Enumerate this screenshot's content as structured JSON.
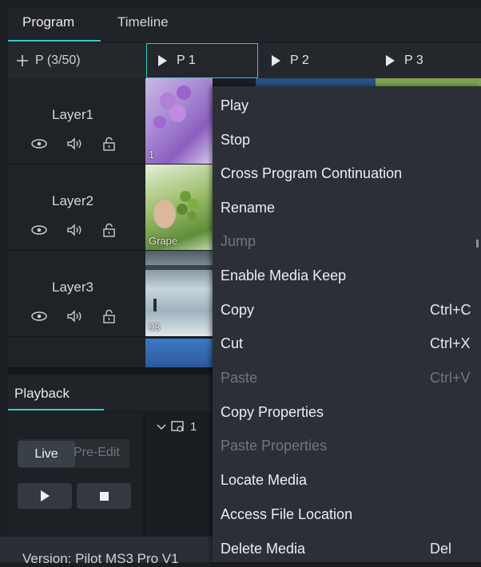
{
  "tabs": {
    "program": "Program",
    "timeline": "Timeline"
  },
  "program_header": {
    "add_label": "P (3/50)",
    "programs": [
      "P 1",
      "P 2",
      "P 3"
    ]
  },
  "layers": [
    {
      "name": "Layer1",
      "thumb_label": "1"
    },
    {
      "name": "Layer2",
      "thumb_label": "Grape"
    },
    {
      "name": "Layer3",
      "thumb_label": "03"
    }
  ],
  "playback": {
    "title": "Playback",
    "live": "Live",
    "pre_edit": "Pre-Edit",
    "mid_label": "1"
  },
  "version": "Version: Pilot MS3 Pro V1",
  "context_menu": {
    "items": [
      {
        "label": "Play",
        "shortcut": "",
        "enabled": true
      },
      {
        "label": "Stop",
        "shortcut": "",
        "enabled": true
      },
      {
        "label": "Cross Program Continuation",
        "shortcut": "",
        "enabled": true
      },
      {
        "label": "Rename",
        "shortcut": "",
        "enabled": true
      },
      {
        "label": "Jump",
        "shortcut": "",
        "enabled": false
      },
      {
        "label": "Enable Media Keep",
        "shortcut": "",
        "enabled": true
      },
      {
        "label": "Copy",
        "shortcut": "Ctrl+C",
        "enabled": true
      },
      {
        "label": "Cut",
        "shortcut": "Ctrl+X",
        "enabled": true
      },
      {
        "label": "Paste",
        "shortcut": "Ctrl+V",
        "enabled": false
      },
      {
        "label": "Copy Properties",
        "shortcut": "",
        "enabled": true
      },
      {
        "label": "Paste Properties",
        "shortcut": "",
        "enabled": false
      },
      {
        "label": "Locate Media",
        "shortcut": "",
        "enabled": true
      },
      {
        "label": "Access File Location",
        "shortcut": "",
        "enabled": true
      },
      {
        "label": "Delete Media",
        "shortcut": "Del",
        "enabled": true
      }
    ]
  },
  "colors": {
    "accent": "#3cc8c8",
    "menu_bg": "#2c3036",
    "disabled_text": "#6f767e"
  }
}
